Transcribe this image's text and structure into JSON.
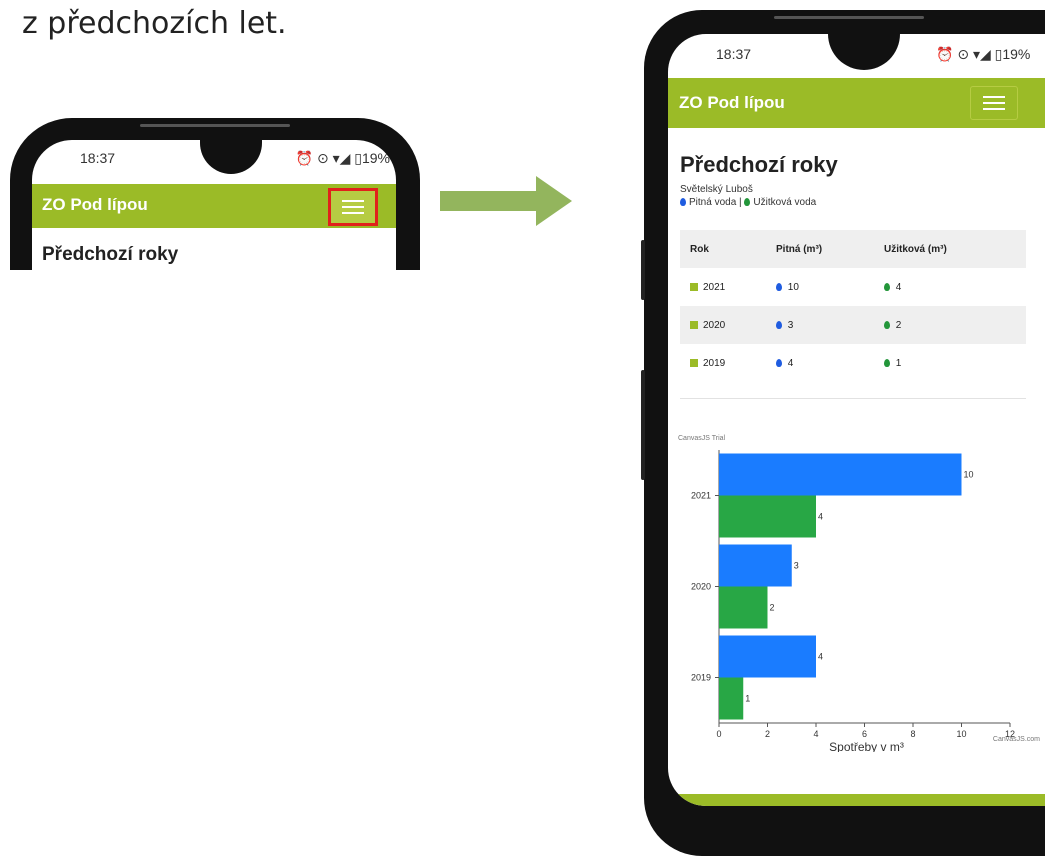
{
  "intro_text": "z předchozích let.",
  "status": {
    "time": "18:37",
    "right_icons": "⏰ ⊙ ▾◢ ▯19%"
  },
  "app": {
    "title": "ZO Pod lípou"
  },
  "page": {
    "heading": "Předchozí roky",
    "owner": "Světelský Luboš",
    "legend_potable": "Pitná voda |",
    "legend_utility": "Užitková voda"
  },
  "table": {
    "headers": [
      "Rok",
      "Pitná (m³)",
      "Užitková (m³)"
    ],
    "rows": [
      {
        "year": "2021",
        "potable": "10",
        "utility": "4"
      },
      {
        "year": "2020",
        "potable": "3",
        "utility": "2"
      },
      {
        "year": "2019",
        "potable": "4",
        "utility": "1"
      }
    ]
  },
  "colors": {
    "brand": "#9bbb27",
    "potable": "#1a7cff",
    "utility": "#28a745",
    "highlight": "#e0211b"
  },
  "chart_data": {
    "type": "bar",
    "orientation": "horizontal",
    "categories": [
      "2021",
      "2020",
      "2019"
    ],
    "series": [
      {
        "name": "Pitná voda",
        "values": [
          10,
          3,
          4
        ]
      },
      {
        "name": "Užitková voda",
        "values": [
          4,
          2,
          1
        ]
      }
    ],
    "xlabel": "Spotřeby v m³",
    "xlim": [
      0,
      12
    ],
    "xticks": [
      "0",
      "2",
      "4",
      "6",
      "8",
      "10",
      "12"
    ],
    "watermark": "CanvasJS Trial",
    "credit": "CanvasJS.com"
  }
}
